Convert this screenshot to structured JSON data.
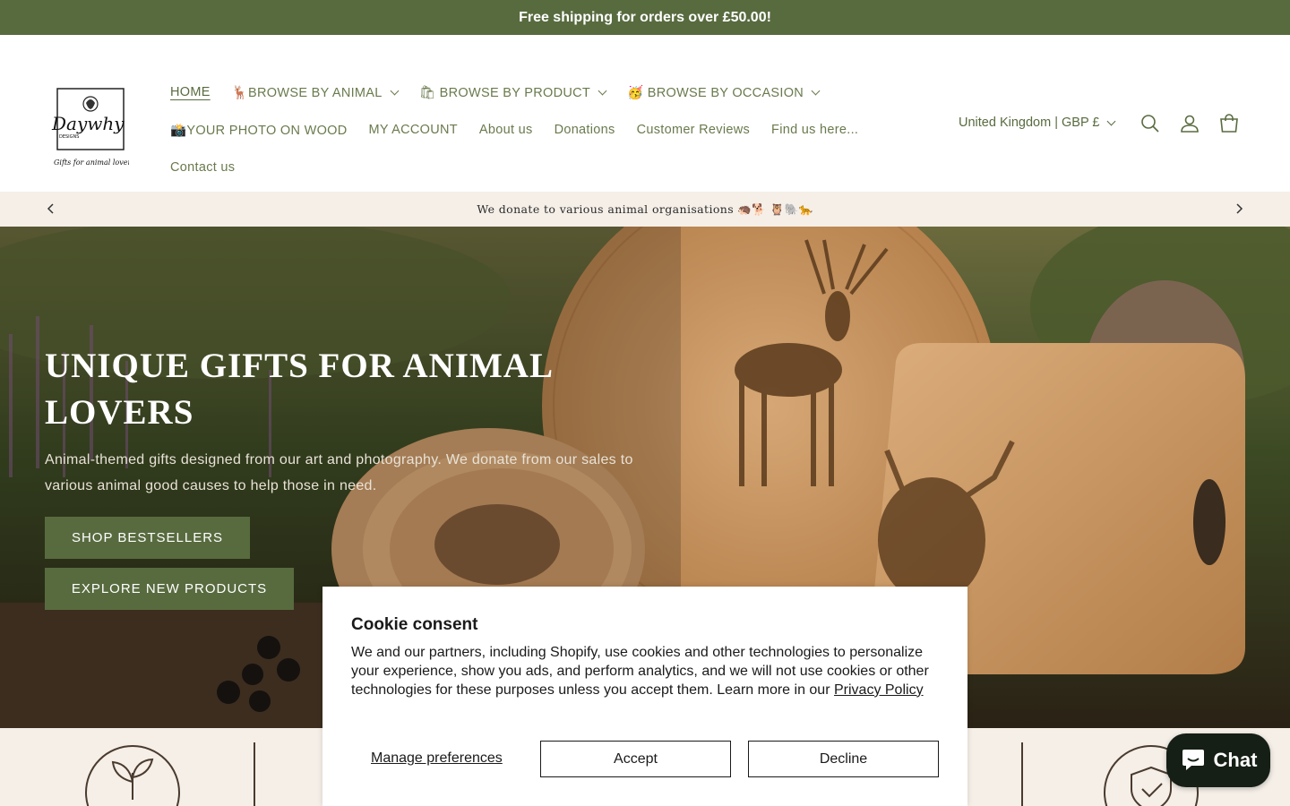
{
  "announcement": "Free shipping for orders over £50.00!",
  "logo": {
    "brand_text": "Daywhy",
    "sub_text": "DESIGNS",
    "tagline": "Gifts for animal lovers"
  },
  "nav": {
    "items": [
      {
        "label": "HOME"
      },
      {
        "label": "🦌BROWSE BY ANIMAL"
      },
      {
        "label": "🛍 BROWSE BY PRODUCT"
      },
      {
        "label": "🥳 BROWSE BY OCCASION"
      },
      {
        "label": "📸YOUR PHOTO ON WOOD"
      },
      {
        "label": "MY ACCOUNT"
      },
      {
        "label": "About us"
      },
      {
        "label": "Donations"
      },
      {
        "label": "Customer Reviews"
      },
      {
        "label": "Find us here..."
      },
      {
        "label": "Contact us"
      }
    ]
  },
  "region": {
    "label": "United Kingdom | GBP £"
  },
  "icons": {
    "search": "search-icon",
    "account": "account-icon",
    "cart": "cart-icon",
    "prev": "chevron-left-icon",
    "next": "chevron-right-icon"
  },
  "sub_announcement": "We donate to various animal organisations 🦔🐕 🦉🐘🐆",
  "hero": {
    "title": "UNIQUE GIFTS FOR ANIMAL LOVERS",
    "subtitle": "Animal-themed gifts designed from our art and photography. We donate from our sales to various animal good causes to help those in need.",
    "button_primary": "SHOP BESTSELLERS",
    "button_secondary": "EXPLORE NEW PRODUCTS"
  },
  "cookie": {
    "title": "Cookie consent",
    "body": "We and our partners, including Shopify, use cookies and other technologies to personalize your experience, show you ads, and perform analytics, and we will not use cookies or other technologies for these purposes unless you accept them. Learn more in our ",
    "link": "Privacy Policy",
    "manage": "Manage preferences",
    "accept": "Accept",
    "decline": "Decline"
  },
  "chat": {
    "label": "Chat"
  },
  "colors": {
    "brand_green": "#586b3f",
    "cream": "#f5efe8",
    "chat_bg": "#151f15"
  }
}
